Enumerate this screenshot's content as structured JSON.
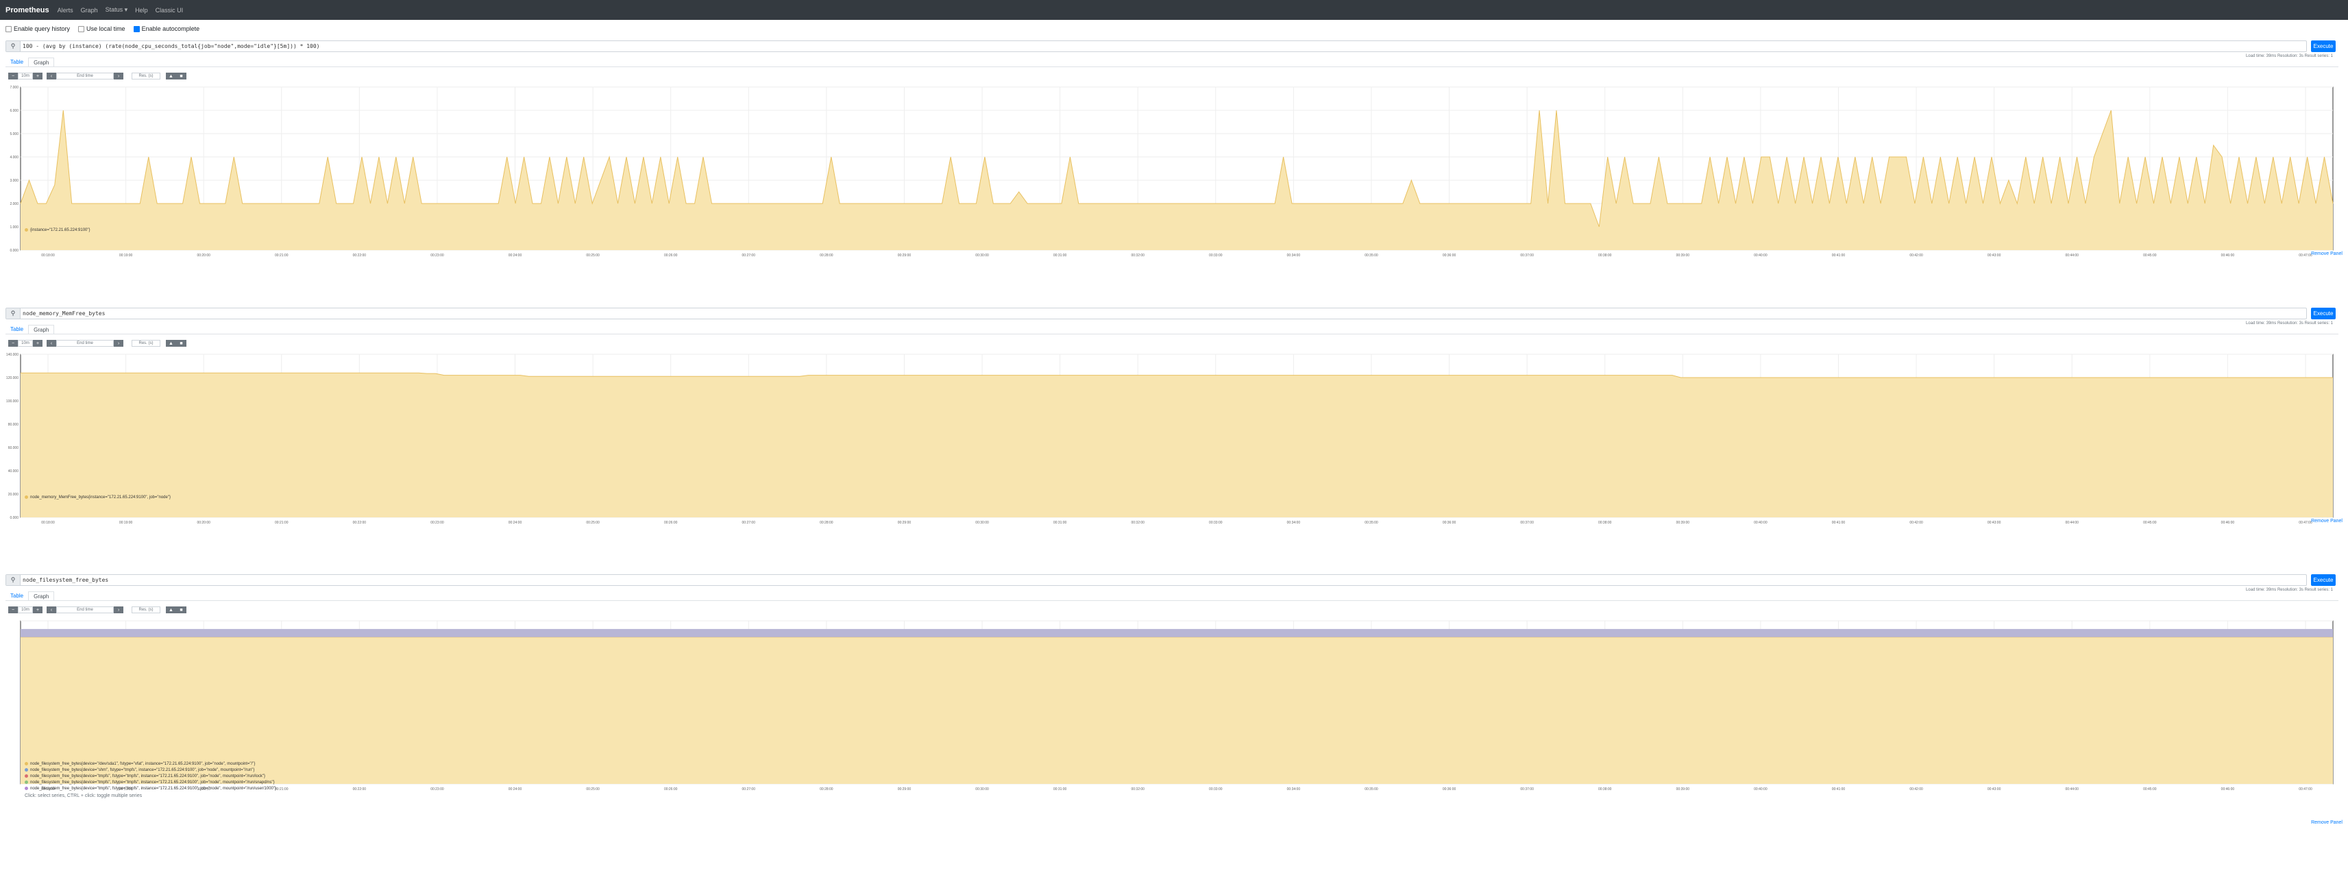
{
  "navbar": {
    "brand": "Prometheus",
    "items": [
      "Alerts",
      "Graph",
      "Status ▾",
      "Help",
      "Classic UI"
    ]
  },
  "options": [
    {
      "label": "Enable query history",
      "checked": false
    },
    {
      "label": "Use local time",
      "checked": false
    },
    {
      "label": "Enable autocomplete",
      "checked": true
    }
  ],
  "common": {
    "execute_label": "Execute",
    "meta_text": "Load time: 39ms   Resolution: 3s   Result series: 1",
    "tab_table": "Table",
    "tab_graph": "Graph",
    "range": "10m",
    "end_time_placeholder": "End time",
    "res_placeholder": "Res. (s)",
    "remove_label": "Remove Panel",
    "minus": "−",
    "plus": "+",
    "prev": "‹",
    "next": "›",
    "accent_color": "#007bff",
    "area_fill": "#f8e5b0",
    "area_stroke": "#e8c060"
  },
  "panels": [
    {
      "query": "100 - (avg by (instance) (rate(node_cpu_seconds_total{job=\"node\",mode=\"idle\"}[5m])) * 100)",
      "legend": [
        "{instance=\"172.21.65.224:9100\"}"
      ],
      "hint": "",
      "chart_data": {
        "type": "area",
        "ylim": [
          0,
          7
        ],
        "yticks": [
          "7.000",
          "6.000",
          "5.000",
          "4.000",
          "3.000",
          "2.000",
          "1.000",
          "0.000"
        ],
        "xticks": [
          "00:18:00",
          "00:19:00",
          "00:20:00",
          "00:21:00",
          "00:22:00",
          "00:23:00",
          "00:24:00",
          "00:25:00",
          "00:26:00",
          "00:27:00",
          "00:28:00",
          "00:29:00",
          "00:30:00",
          "00:31:00",
          "00:32:00",
          "00:33:00",
          "00:34:00",
          "00:35:00",
          "00:36:00",
          "00:37:00",
          "00:38:00",
          "00:39:00",
          "00:40:00",
          "00:41:00",
          "00:42:00",
          "00:43:00",
          "00:44:00",
          "00:45:00",
          "00:46:00",
          "00:47:00"
        ],
        "series": [
          {
            "name": "{instance=\"172.21.65.224:9100\"}",
            "values": [
              2.0,
              3.0,
              2.0,
              2.0,
              2.8,
              6.0,
              2.0,
              2.0,
              2.0,
              2.0,
              2.0,
              2.0,
              2.0,
              2.0,
              2.0,
              4.0,
              2.0,
              2.0,
              2.0,
              2.0,
              4.0,
              2.0,
              2.0,
              2.0,
              2.0,
              4.0,
              2.0,
              2.0,
              2.0,
              2.0,
              2.0,
              2.0,
              2.0,
              2.0,
              2.0,
              2.0,
              4.0,
              2.0,
              2.0,
              2.0,
              4.0,
              2.0,
              4.0,
              2.0,
              4.0,
              2.0,
              4.0,
              2.0,
              2.0,
              2.0,
              2.0,
              2.0,
              2.0,
              2.0,
              2.0,
              2.0,
              2.0,
              4.0,
              2.0,
              4.0,
              2.0,
              2.0,
              4.0,
              2.0,
              4.0,
              2.0,
              4.0,
              2.0,
              3.0,
              4.0,
              2.0,
              4.0,
              2.0,
              4.0,
              2.0,
              4.0,
              2.0,
              4.0,
              2.0,
              2.0,
              4.0,
              2.0,
              2.0,
              2.0,
              2.0,
              2.0,
              2.0,
              2.0,
              2.0,
              2.0,
              2.0,
              2.0,
              2.0,
              2.0,
              2.0,
              4.0,
              2.0,
              2.0,
              2.0,
              2.0,
              2.0,
              2.0,
              2.0,
              2.0,
              2.0,
              2.0,
              2.0,
              2.0,
              2.0,
              4.0,
              2.0,
              2.0,
              2.0,
              4.0,
              2.0,
              2.0,
              2.0,
              2.5,
              2.0,
              2.0,
              2.0,
              2.0,
              2.0,
              4.0,
              2.0,
              2.0,
              2.0,
              2.0,
              2.0,
              2.0,
              2.0,
              2.0,
              2.0,
              2.0,
              2.0,
              2.0,
              2.0,
              2.0,
              2.0,
              2.0,
              2.0,
              2.0,
              2.0,
              2.0,
              2.0,
              2.0,
              2.0,
              2.0,
              4.0,
              2.0,
              2.0,
              2.0,
              2.0,
              2.0,
              2.0,
              2.0,
              2.0,
              2.0,
              2.0,
              2.0,
              2.0,
              2.0,
              2.0,
              3.0,
              2.0,
              2.0,
              2.0,
              2.0,
              2.0,
              2.0,
              2.0,
              2.0,
              2.0,
              2.0,
              2.0,
              2.0,
              2.0,
              2.0,
              6.0,
              2.0,
              6.0,
              2.0,
              2.0,
              2.0,
              2.0,
              1.0,
              4.0,
              2.0,
              4.0,
              2.0,
              2.0,
              2.0,
              4.0,
              2.0,
              2.0,
              2.0,
              2.0,
              2.0,
              4.0,
              2.0,
              4.0,
              2.0,
              4.0,
              2.0,
              4.0,
              4.0,
              2.0,
              4.0,
              2.0,
              4.0,
              2.0,
              4.0,
              2.0,
              4.0,
              2.0,
              4.0,
              2.0,
              4.0,
              2.0,
              4.0,
              4.0,
              4.0,
              2.0,
              4.0,
              2.0,
              4.0,
              2.0,
              4.0,
              2.0,
              4.0,
              2.0,
              4.0,
              2.0,
              3.0,
              2.0,
              4.0,
              2.0,
              4.0,
              2.0,
              4.0,
              2.0,
              4.0,
              2.0,
              4.0,
              5.0,
              6.0,
              2.0,
              4.0,
              2.0,
              4.0,
              2.0,
              4.0,
              2.0,
              4.0,
              2.0,
              4.0,
              2.0,
              4.5,
              4.0,
              2.0,
              4.0,
              2.0,
              4.0,
              2.0,
              4.0,
              2.0,
              4.0,
              2.0,
              4.0,
              2.0,
              4.0,
              2.0
            ]
          }
        ]
      }
    },
    {
      "query": "node_memory_MemFree_bytes",
      "legend": [
        "node_memory_MemFree_bytes{instance=\"172.21.65.224:9100\", job=\"node\"}"
      ],
      "hint": "",
      "chart_data": {
        "type": "area",
        "ylim": [
          0,
          140000
        ],
        "yticks": [
          "140.000",
          "120.000",
          "100.000",
          "80.000",
          "60.000",
          "40.000",
          "20.000",
          "0.000"
        ],
        "xticks": [
          "00:18:00",
          "00:19:00",
          "00:20:00",
          "00:21:00",
          "00:22:00",
          "00:23:00",
          "00:24:00",
          "00:25:00",
          "00:26:00",
          "00:27:00",
          "00:28:00",
          "00:29:00",
          "00:30:00",
          "00:31:00",
          "00:32:00",
          "00:33:00",
          "00:34:00",
          "00:35:00",
          "00:36:00",
          "00:37:00",
          "00:38:00",
          "00:39:00",
          "00:40:00",
          "00:41:00",
          "00:42:00",
          "00:43:00",
          "00:44:00",
          "00:45:00",
          "00:46:00",
          "00:47:00"
        ],
        "series": [
          {
            "name": "node_memory_MemFree_bytes",
            "values": [
              124000,
              124000,
              124000,
              124000,
              124000,
              124000,
              124000,
              124000,
              124000,
              124000,
              124000,
              124000,
              124000,
              124000,
              124000,
              124000,
              124000,
              124000,
              124000,
              124000,
              124000,
              124000,
              124000,
              124000,
              124000,
              124000,
              124000,
              124000,
              124000,
              124000,
              124000,
              124000,
              124000,
              124000,
              124000,
              124000,
              124000,
              124000,
              124000,
              124000,
              124000,
              124000,
              124000,
              124000,
              124000,
              124000,
              124000,
              124000,
              123500,
              123500,
              122000,
              122000,
              122000,
              122000,
              122000,
              122000,
              122000,
              122000,
              122000,
              122000,
              121000,
              121000,
              121000,
              121000,
              121000,
              121000,
              121000,
              121000,
              121000,
              121000,
              121000,
              121000,
              121000,
              121000,
              121000,
              121000,
              121000,
              121000,
              121000,
              121000,
              121000,
              121000,
              121000,
              121000,
              121000,
              121000,
              121000,
              121000,
              121000,
              121000,
              121000,
              121000,
              121000,
              122000,
              122000,
              122000,
              122000,
              122000,
              122000,
              122000,
              122000,
              122000,
              122000,
              122000,
              122000,
              122000,
              122000,
              122000,
              122000,
              122000,
              122000,
              122000,
              122000,
              122000,
              122000,
              122000,
              122000,
              122000,
              122000,
              122000,
              122000,
              122000,
              122000,
              122000,
              122000,
              122000,
              122000,
              122000,
              122000,
              122000,
              122000,
              122000,
              122000,
              122000,
              122000,
              122000,
              122000,
              122000,
              122000,
              122000,
              122000,
              122000,
              122000,
              122000,
              122000,
              122000,
              122000,
              122000,
              122000,
              122000,
              122000,
              122000,
              122000,
              122000,
              122000,
              122000,
              122000,
              122000,
              122000,
              122000,
              122000,
              122000,
              122000,
              122000,
              122000,
              122000,
              122000,
              122000,
              122000,
              122000,
              122000,
              122000,
              122000,
              122000,
              122000,
              122000,
              122000,
              122000,
              122000,
              122000,
              122000,
              122000,
              122000,
              122000,
              122000,
              122000,
              122000,
              122000,
              122000,
              122000,
              122000,
              122000,
              122000,
              122000,
              122000,
              122000,
              120000,
              120000,
              120000,
              120000,
              120000,
              120000,
              120000,
              120000,
              120000,
              120000,
              120000,
              120000,
              120000,
              120000,
              120000,
              120000,
              120000,
              120000,
              120000,
              120000,
              120000,
              120000,
              120000,
              120000,
              120000,
              120000,
              120000,
              120000,
              120000,
              120000,
              120000,
              120000,
              120000,
              120000,
              120000,
              120000,
              120000,
              120000,
              120000,
              120000,
              120000,
              120000,
              120000,
              120000,
              120000,
              120000,
              120000,
              120000,
              120000,
              120000,
              120000,
              120000,
              120000,
              120000,
              120000,
              120000,
              120000,
              120000,
              120000,
              120000,
              120000,
              120000,
              120000,
              120000,
              120000,
              120000,
              120000,
              120000,
              120000,
              120000,
              120000,
              120000,
              120000,
              120000,
              120000,
              120000,
              120000,
              120000
            ]
          }
        ]
      }
    },
    {
      "query": "node_filesystem_free_bytes",
      "legend": [
        "node_filesystem_free_bytes{device=\"/dev/sda1\", fstype=\"vfat\", instance=\"172.21.65.224:9100\", job=\"node\", mountpoint=\"/\"}",
        "node_filesystem_free_bytes{device=\"shm\", fstype=\"tmpfs\", instance=\"172.21.65.224:9100\", job=\"node\", mountpoint=\"/run\"}",
        "node_filesystem_free_bytes{device=\"tmpfs\", fstype=\"tmpfs\", instance=\"172.21.65.224:9100\", job=\"node\", mountpoint=\"/run/lock\"}",
        "node_filesystem_free_bytes{device=\"tmpfs\", fstype=\"tmpfs\", instance=\"172.21.65.224:9100\", job=\"node\", mountpoint=\"/run/snapd/ns\"}",
        "node_filesystem_free_bytes{device=\"tmpfs\", fstype=\"tmpfs\", instance=\"172.21.65.224:9100\", job=\"node\", mountpoint=\"/run/user/1000\"}"
      ],
      "hint": "Click: select series, CTRL + click: toggle multiple series",
      "chart_data": {
        "type": "area",
        "ylim": [
          0,
          1
        ],
        "yticks": [
          "",
          "",
          "",
          "",
          "",
          "",
          "",
          ""
        ],
        "xticks": [
          "00:18:00",
          "00:19:00",
          "00:20:00",
          "00:21:00",
          "00:22:00",
          "00:23:00",
          "00:24:00",
          "00:25:00",
          "00:26:00",
          "00:27:00",
          "00:28:00",
          "00:29:00",
          "00:30:00",
          "00:31:00",
          "00:32:00",
          "00:33:00",
          "00:34:00",
          "00:35:00",
          "00:36:00",
          "00:37:00",
          "00:38:00",
          "00:39:00",
          "00:40:00",
          "00:41:00",
          "00:42:00",
          "00:43:00",
          "00:44:00",
          "00:45:00",
          "00:46:00",
          "00:47:00"
        ],
        "series": [
          {
            "name": "node_filesystem_free_bytes",
            "values": [
              0.9,
              0.9,
              0.9,
              0.9,
              0.9,
              0.9,
              0.9,
              0.9,
              0.9,
              0.9,
              0.9,
              0.9,
              0.9,
              0.9,
              0.9,
              0.9,
              0.9,
              0.9,
              0.9,
              0.9,
              0.9,
              0.9,
              0.9,
              0.9,
              0.9,
              0.9,
              0.9,
              0.9,
              0.9,
              0.9
            ]
          }
        ]
      }
    }
  ]
}
